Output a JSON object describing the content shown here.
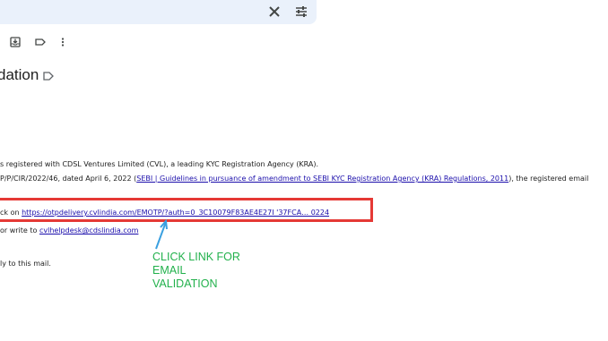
{
  "search": {
    "clear_icon": "close-icon",
    "options_icon": "tune-icon"
  },
  "toolbar": {
    "icons": [
      "move-to-inbox-icon",
      "label-icon",
      "more-vert-icon"
    ]
  },
  "email": {
    "subject": "dation",
    "body": {
      "line1": "s registered with CDSL Ventures Limited (CVL), a leading KYC Registration Agency (KRA).",
      "line2_prefix": "P/P/CIR/2022/46, dated April 6, 2022 (",
      "line2_link": "SEBI | Guidelines in pursuance of amendment to SEBI KYC Registration Agency (KRA) Regulations, 2011",
      "line2_suffix": "), the registered email",
      "line3_prefix": "ck on ",
      "line3_link": "https://otpdelivery.cvlindia.com/EMOTP/?auth=0_3C10079F83AE4E27I   '37FCA… 0224",
      "line4_prefix": "or write to ",
      "line4_link": "cvlhelpdesk@cdslindia.com",
      "line5": "ly to this mail."
    }
  },
  "annotation": {
    "lines": [
      "CLICK LINK FOR",
      "EMAIL",
      "VALIDATION"
    ],
    "color": "#22b14c",
    "box_color": "#e53935"
  }
}
